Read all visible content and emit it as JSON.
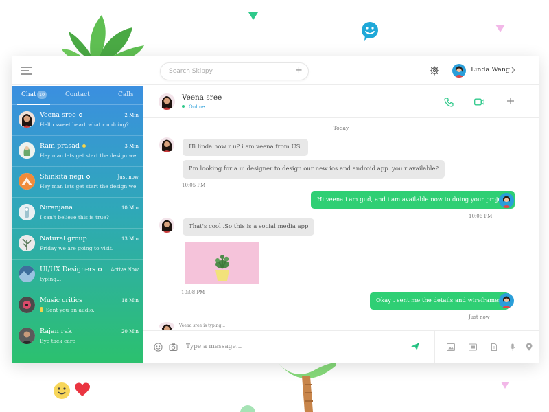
{
  "search": {
    "placeholder": "Search Skippy",
    "plus_label": "+"
  },
  "user": {
    "name": "Linda Wang"
  },
  "tabs": [
    {
      "label": "Chat",
      "badge": "10"
    },
    {
      "label": "Contact"
    },
    {
      "label": "Calls"
    }
  ],
  "conversations": [
    {
      "name": "Veena sree",
      "time": "2 Min",
      "preview": "Hello sweet heart what r u doing?",
      "status": "online"
    },
    {
      "name": "Ram prasad",
      "time": "3 Min",
      "preview": "Hey man lets get start the design we ...",
      "status": "away"
    },
    {
      "name": "Shinkita negi",
      "time": "Just now",
      "preview": "Hey man lets get start the design we ...",
      "status": "online"
    },
    {
      "name": "Niranjana",
      "time": "10 Min",
      "preview": "I can't believe this is true?"
    },
    {
      "name": "Natural group",
      "time": "13 Min",
      "preview": "Friday we are going to visit."
    },
    {
      "name": "UI/UX Designers",
      "time": "Active Now",
      "preview": "typing...",
      "status": "online"
    },
    {
      "name": "Music critics",
      "time": "18 Min",
      "preview": "Sent you an audio."
    },
    {
      "name": "Rajan rak",
      "time": "20 Min",
      "preview": "Bye tack care"
    }
  ],
  "chat": {
    "contact_name": "Veena sree",
    "contact_status": "Online",
    "day_label": "Today",
    "messages": [
      {
        "direction": "in",
        "text": "Hi linda how r u? i am veena from US."
      },
      {
        "direction": "in",
        "text": "I'm looking for a ui designer to design our new ios and android app. you r available?"
      },
      {
        "direction": "in",
        "text": "10:05 PM",
        "kind": "timestamp"
      },
      {
        "direction": "out",
        "text": "Hi veena i am gud, and i am available now to doing your project."
      },
      {
        "direction": "out",
        "text": "10:06 PM",
        "kind": "timestamp"
      },
      {
        "direction": "in",
        "text": "That's cool .So this is a social media app"
      },
      {
        "direction": "in",
        "text": "10:08 PM",
        "kind": "timestamp"
      },
      {
        "direction": "out",
        "text": "Okay . sent me the details and wireframes."
      },
      {
        "direction": "out",
        "text": "Just now",
        "kind": "timestamp"
      }
    ],
    "typing_text": "Veena sree is typing..."
  },
  "composer": {
    "placeholder": "Type a message..."
  },
  "colors": {
    "sidebar_top": "#3b8fe0",
    "sidebar_bottom": "#2cc16e",
    "bubble_out": "#2fcf74",
    "bubble_in": "#e8e8e8",
    "accent_green": "#2fc98b"
  },
  "icons": [
    "menu-icon",
    "gear-icon",
    "chevron-right-icon",
    "phone-icon",
    "video-icon",
    "plus-icon",
    "smile-icon",
    "camera-icon",
    "send-icon",
    "image-icon",
    "gallery-icon",
    "document-icon",
    "microphone-icon",
    "location-icon"
  ]
}
